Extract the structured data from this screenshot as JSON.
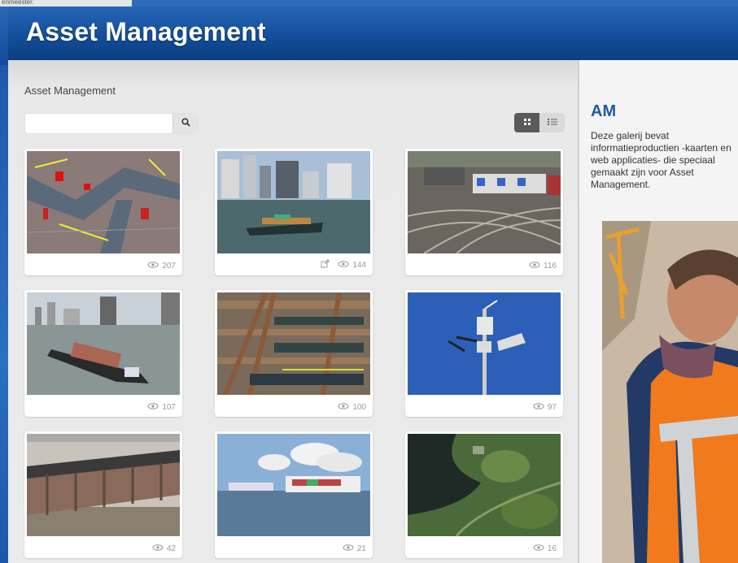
{
  "corner_note": "enmeester.",
  "header": {
    "title": "Asset Management"
  },
  "breadcrumb": "Asset Management",
  "search": {
    "placeholder": "",
    "value": ""
  },
  "icons": {
    "search": "search-icon",
    "grid_view": "grid-view-icon",
    "list_view": "list-view-icon",
    "views": "eye-icon",
    "external": "external-link-icon"
  },
  "gallery": [
    {
      "views": "207",
      "external": false
    },
    {
      "views": "144",
      "external": true
    },
    {
      "views": "116",
      "external": false
    },
    {
      "views": "107",
      "external": false
    },
    {
      "views": "100",
      "external": false
    },
    {
      "views": "97",
      "external": false
    },
    {
      "views": "42",
      "external": false
    },
    {
      "views": "21",
      "external": false
    },
    {
      "views": "16",
      "external": false
    }
  ],
  "sidebar": {
    "title": "AM",
    "description": "Deze galerij bevat informatieproductien -kaarten en web applicaties- die speciaal gemaakt zijn voor Asset Management."
  },
  "colors": {
    "header_blue": "#134c98",
    "accent_blue": "#1f5aa3",
    "content_bg": "#ebebeb"
  }
}
